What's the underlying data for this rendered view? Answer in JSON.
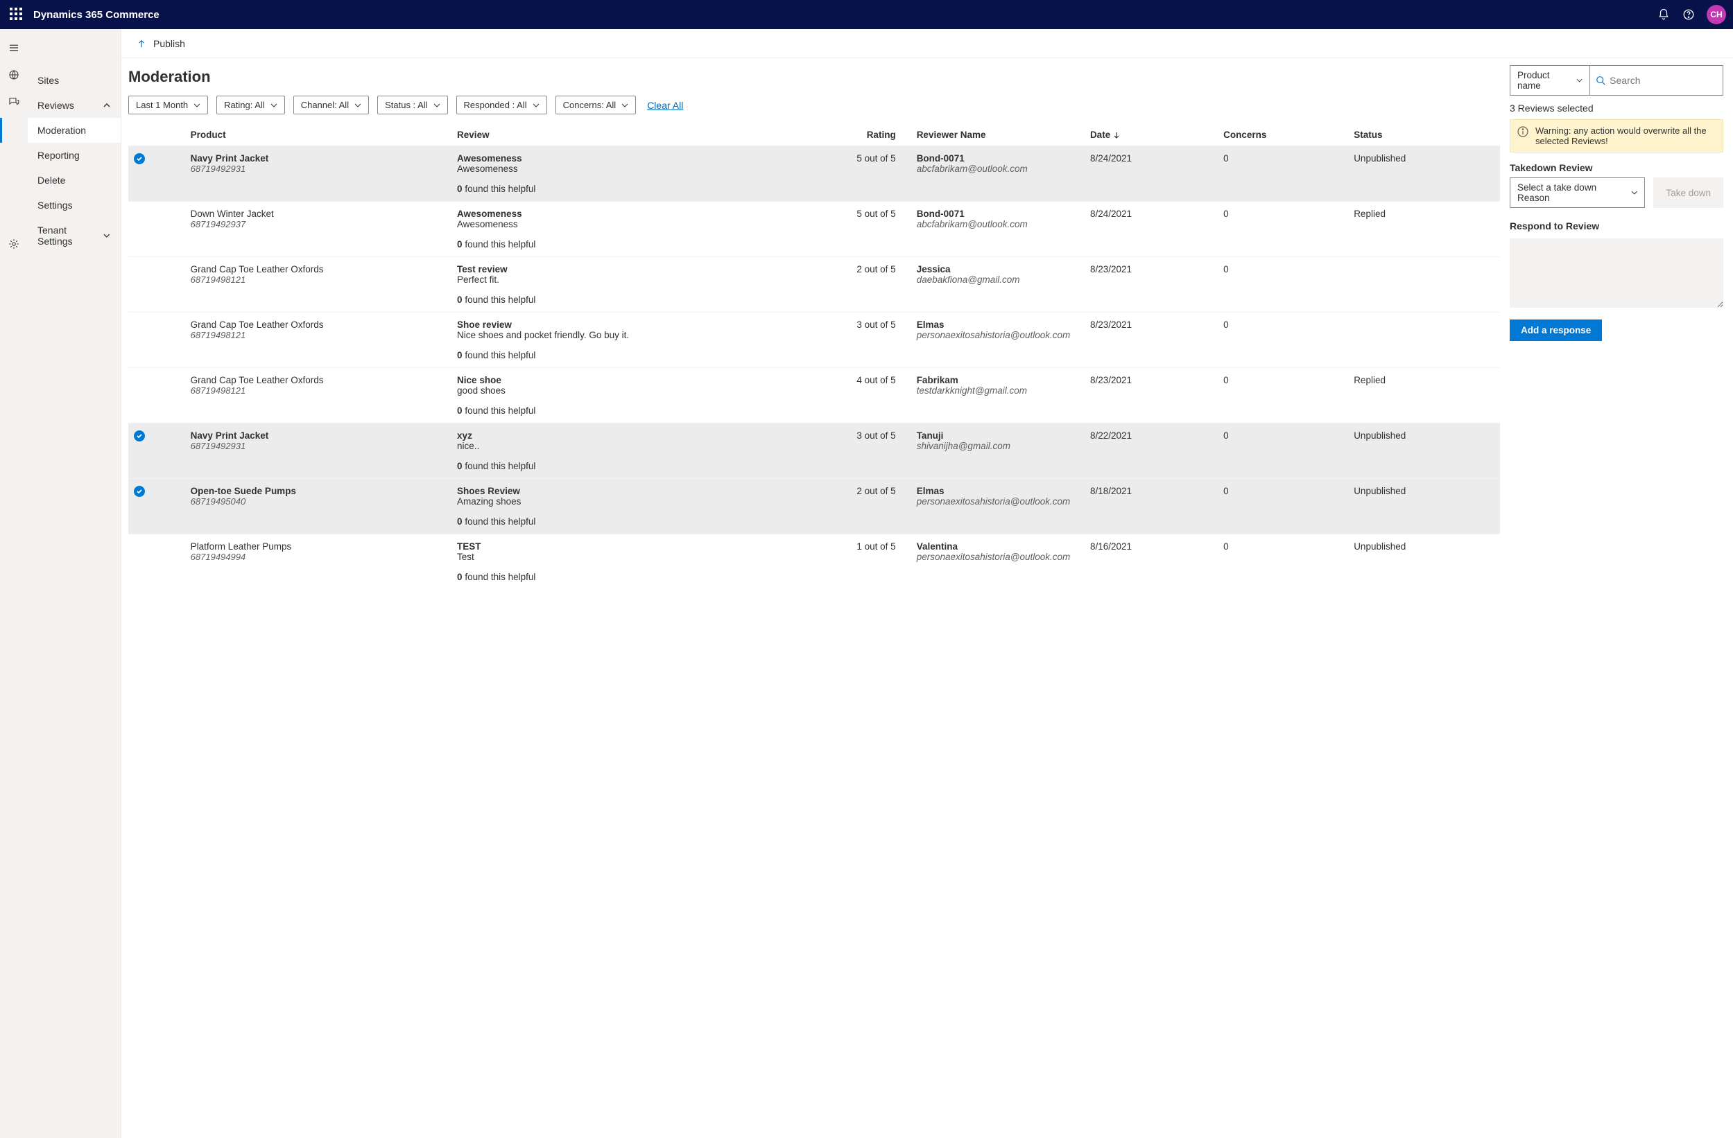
{
  "topbar": {
    "app_title": "Dynamics 365 Commerce",
    "avatar": "CH"
  },
  "nav": {
    "sites": "Sites",
    "reviews": "Reviews",
    "moderation": "Moderation",
    "reporting": "Reporting",
    "delete": "Delete",
    "settings": "Settings",
    "tenant_settings": "Tenant Settings"
  },
  "publish": {
    "label": "Publish"
  },
  "page": {
    "title": "Moderation"
  },
  "filters": {
    "date": "Last 1 Month",
    "rating": "Rating: All",
    "channel": "Channel: All",
    "status": "Status : All",
    "responded": "Responded : All",
    "concerns": "Concerns: All",
    "clear": "Clear All"
  },
  "columns": {
    "product": "Product",
    "review": "Review",
    "rating": "Rating",
    "reviewer": "Reviewer Name",
    "date": "Date",
    "concerns": "Concerns",
    "status": "Status"
  },
  "helpful_suffix": " found this helpful",
  "rows": [
    {
      "selected": true,
      "product": "Navy Print Jacket",
      "sku": "68719492931",
      "title": "Awesomeness",
      "body": "Awesomeness",
      "helpful": "0",
      "rating": "5 out of 5",
      "reviewer": "Bond-0071",
      "email": "abcfabrikam@outlook.com",
      "date": "8/24/2021",
      "concerns": "0",
      "status": "Unpublished"
    },
    {
      "selected": false,
      "product": "Down Winter Jacket",
      "sku": "68719492937",
      "title": "Awesomeness",
      "body": "Awesomeness",
      "helpful": "0",
      "rating": "5 out of 5",
      "reviewer": "Bond-0071",
      "email": "abcfabrikam@outlook.com",
      "date": "8/24/2021",
      "concerns": "0",
      "status": "Replied"
    },
    {
      "selected": false,
      "product": "Grand Cap Toe Leather Oxfords",
      "sku": "68719498121",
      "title": "Test review",
      "body": "Perfect fit.",
      "helpful": "0",
      "rating": "2 out of 5",
      "reviewer": "Jessica",
      "email": "daebakfiona@gmail.com",
      "date": "8/23/2021",
      "concerns": "0",
      "status": ""
    },
    {
      "selected": false,
      "product": "Grand Cap Toe Leather Oxfords",
      "sku": "68719498121",
      "title": "Shoe review",
      "body": "Nice shoes and pocket friendly. Go buy it.",
      "helpful": "0",
      "rating": "3 out of 5",
      "reviewer": "Elmas",
      "email": "personaexitosahistoria@outlook.com",
      "date": "8/23/2021",
      "concerns": "0",
      "status": ""
    },
    {
      "selected": false,
      "product": "Grand Cap Toe Leather Oxfords",
      "sku": "68719498121",
      "title": "Nice shoe",
      "body": "good shoes",
      "helpful": "0",
      "rating": "4 out of 5",
      "reviewer": "Fabrikam",
      "email": "testdarkknight@gmail.com",
      "date": "8/23/2021",
      "concerns": "0",
      "status": "Replied"
    },
    {
      "selected": true,
      "product": "Navy Print Jacket",
      "sku": "68719492931",
      "title": "xyz",
      "body": "nice..",
      "helpful": "0",
      "rating": "3 out of 5",
      "reviewer": "Tanuji",
      "email": "shivanijha@gmail.com",
      "date": "8/22/2021",
      "concerns": "0",
      "status": "Unpublished"
    },
    {
      "selected": true,
      "product": "Open-toe Suede Pumps",
      "sku": "68719495040",
      "title": "Shoes Review",
      "body": "Amazing shoes",
      "helpful": "0",
      "rating": "2 out of 5",
      "reviewer": "Elmas",
      "email": "personaexitosahistoria@outlook.com",
      "date": "8/18/2021",
      "concerns": "0",
      "status": "Unpublished"
    },
    {
      "selected": false,
      "product": "Platform Leather Pumps",
      "sku": "68719494994",
      "title": "TEST",
      "body": "Test",
      "helpful": "0",
      "rating": "1 out of 5",
      "reviewer": "Valentina",
      "email": "personaexitosahistoria@outlook.com",
      "date": "8/16/2021",
      "concerns": "0",
      "status": "Unpublished"
    }
  ],
  "right": {
    "search_filter": "Product name",
    "search_placeholder": "Search",
    "selected_text": "3 Reviews selected",
    "warning": "Warning: any action would overwrite all the selected Reviews!",
    "takedown_title": "Takedown Review",
    "takedown_placeholder": "Select a take down Reason",
    "takedown_button": "Take down",
    "respond_title": "Respond to Review",
    "add_response": "Add a response"
  }
}
